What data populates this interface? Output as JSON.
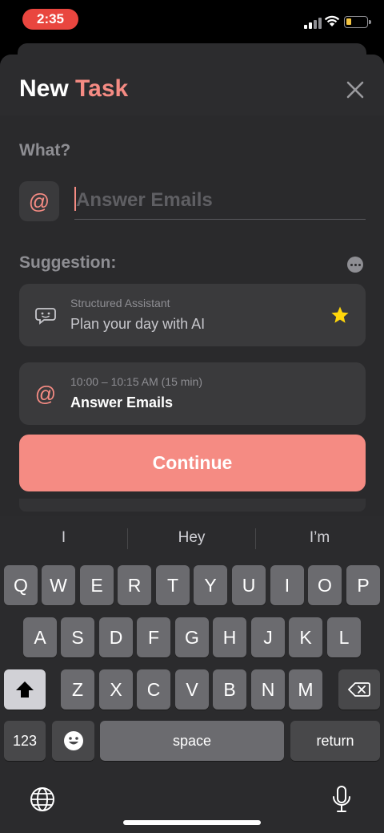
{
  "status_bar": {
    "time": "2:35"
  },
  "sheet": {
    "title_prefix": "New",
    "title_accent": "Task"
  },
  "form": {
    "what_label": "What?",
    "task_placeholder": "Answer Emails",
    "task_value": ""
  },
  "suggestions": {
    "label": "Suggestion:",
    "items": [
      {
        "subtitle": "Structured Assistant",
        "title": "Plan your day with AI"
      },
      {
        "subtitle": "10:00 – 10:15 AM (15 min)",
        "title": "Answer Emails"
      }
    ]
  },
  "continue_label": "Continue",
  "keyboard": {
    "predictions": [
      "I",
      "Hey",
      "I’m"
    ],
    "row1": [
      "Q",
      "W",
      "E",
      "R",
      "T",
      "Y",
      "U",
      "I",
      "O",
      "P"
    ],
    "row2": [
      "A",
      "S",
      "D",
      "F",
      "G",
      "H",
      "J",
      "K",
      "L"
    ],
    "row3": [
      "Z",
      "X",
      "C",
      "V",
      "B",
      "N",
      "M"
    ],
    "numbers_label": "123",
    "space_label": "space",
    "return_label": "return"
  },
  "colors": {
    "accent": "#f58b83",
    "status_time_bg": "#e9463f",
    "star": "#ffd60a"
  }
}
